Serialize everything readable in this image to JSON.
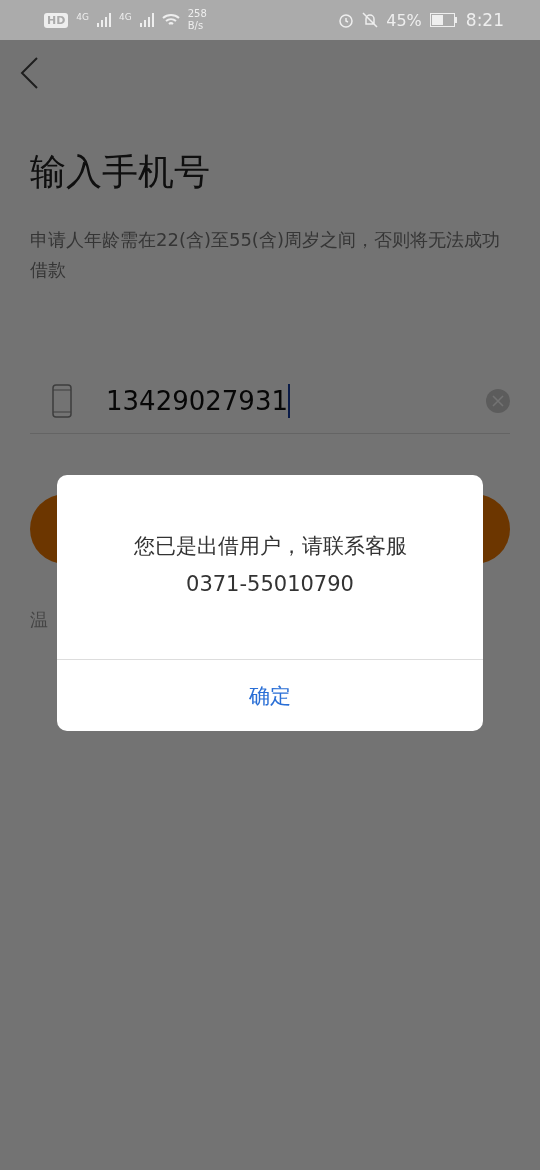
{
  "status_bar": {
    "hd": "HD",
    "network_1": "4G",
    "network_2": "4G",
    "speed_value": "258",
    "speed_unit": "B/s",
    "battery": "45%",
    "time": "8:21"
  },
  "title": "输入手机号",
  "subtitle": "申请人年龄需在22(含)至55(含)周岁之间，否则将无法成功借款",
  "phone_field": {
    "value": "13429027931"
  },
  "tip": "温",
  "dialog": {
    "message": "您已是出借用户，请联系客服",
    "phone": "0371-55010790",
    "confirm": "确定"
  }
}
